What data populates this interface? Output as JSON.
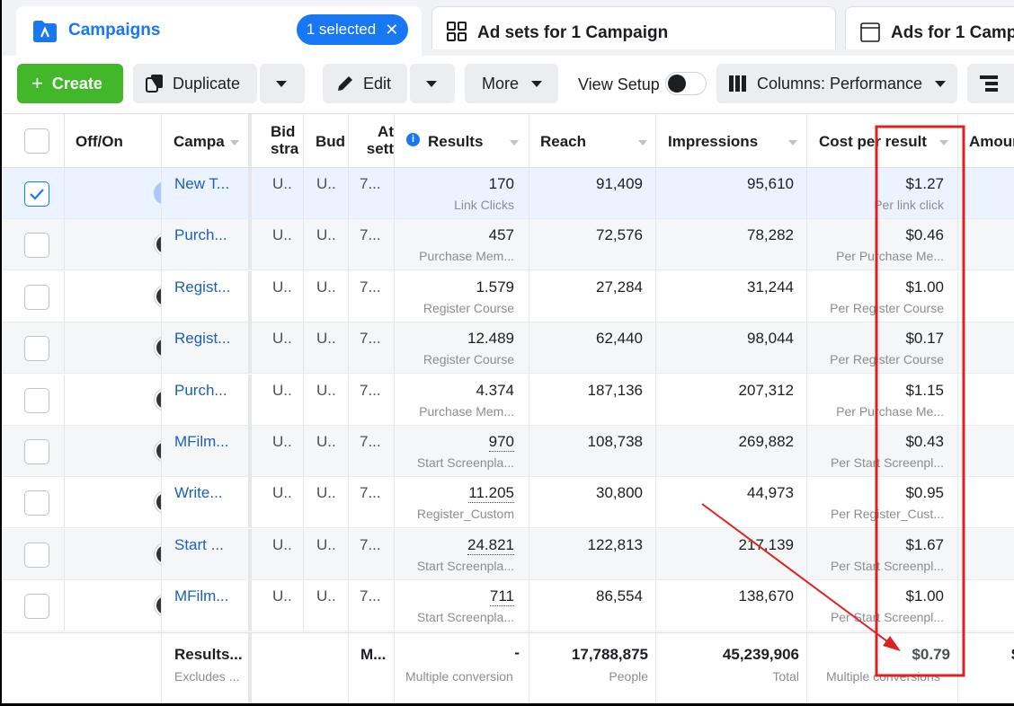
{
  "tabs": {
    "campaigns": "Campaigns",
    "selected": "1 selected",
    "adsets": "Ad sets for 1 Campaign",
    "ads": "Ads for 1 Camp"
  },
  "toolbar": {
    "create": "Create",
    "duplicate": "Duplicate",
    "edit": "Edit",
    "more": "More",
    "view_setup": "View Setup",
    "columns": "Columns: Performance"
  },
  "headers": {
    "offon": "Off/On",
    "campaign": "Campa",
    "bid": "Bid stra",
    "budget": "Bud",
    "attr": "At sett",
    "results": "Results",
    "reach": "Reach",
    "impressions": "Impressions",
    "cost": "Cost per result",
    "amount": "Amour"
  },
  "rows": [
    {
      "name": "New T...",
      "bid": "U..",
      "budget": "U..",
      "attr": "7...",
      "results": "170",
      "results_sub": "Link Clicks",
      "reach": "91,409",
      "impressions": "95,610",
      "cost": "$1.27",
      "cost_sub": "Per link click"
    },
    {
      "name": "Purch...",
      "bid": "U..",
      "budget": "U..",
      "attr": "7...",
      "results": "457",
      "results_sub": "Purchase Mem...",
      "reach": "72,576",
      "impressions": "78,282",
      "cost": "$0.46",
      "cost_sub": "Per Purchase Me..."
    },
    {
      "name": "Regist...",
      "bid": "U..",
      "budget": "U..",
      "attr": "7...",
      "results": "1.579",
      "results_sub": "Register Course",
      "reach": "27,284",
      "impressions": "31,244",
      "cost": "$1.00",
      "cost_sub": "Per Register Course"
    },
    {
      "name": "Regist...",
      "bid": "U..",
      "budget": "U..",
      "attr": "7...",
      "results": "12.489",
      "results_sub": "Register Course",
      "reach": "62,440",
      "impressions": "98,044",
      "cost": "$0.17",
      "cost_sub": "Per Register Course"
    },
    {
      "name": "Purch...",
      "bid": "U..",
      "budget": "U..",
      "attr": "7...",
      "results": "4.374",
      "results_sub": "Purchase Mem...",
      "reach": "187,136",
      "impressions": "207,312",
      "cost": "$1.15",
      "cost_sub": "Per Purchase Me..."
    },
    {
      "name": "MFilm...",
      "bid": "U..",
      "budget": "U..",
      "attr": "7...",
      "results": "970",
      "results_sub": "Start Screenpla...",
      "reach": "108,738",
      "impressions": "269,882",
      "cost": "$0.43",
      "cost_sub": "Per Start Screenpl..."
    },
    {
      "name": "Write...",
      "bid": "U..",
      "budget": "U..",
      "attr": "7...",
      "results": "11.205",
      "results_sub": "Register_Custom",
      "reach": "30,800",
      "impressions": "44,973",
      "cost": "$0.95",
      "cost_sub": "Per Register_Cust..."
    },
    {
      "name": "Start ...",
      "bid": "U..",
      "budget": "U..",
      "attr": "7...",
      "results": "24.821",
      "results_sub": "Start Screenpla...",
      "reach": "122,813",
      "impressions": "217,139",
      "cost": "$1.67",
      "cost_sub": "Per Start Screenpl..."
    },
    {
      "name": "MFilm...",
      "bid": "U..",
      "budget": "U..",
      "attr": "7...",
      "results": "711",
      "results_sub": "Start Screenpla...",
      "reach": "86,554",
      "impressions": "138,670",
      "cost": "$1.00",
      "cost_sub": "Per Start Screenpl..."
    }
  ],
  "totals": {
    "label": "Results...",
    "label_sub": "Excludes ...",
    "attr": "M...",
    "results": "-",
    "results_sub": "Multiple conversion",
    "reach": "17,788,875",
    "reach_sub": "People",
    "impressions": "45,239,906",
    "impressions_sub": "Total",
    "cost": "$0.79",
    "cost_sub": "Multiple conversions"
  },
  "colors": {
    "accent": "#1877f2",
    "create": "#42b72a",
    "annotation": "#e02020",
    "selected_row": "#eaf3ff"
  }
}
